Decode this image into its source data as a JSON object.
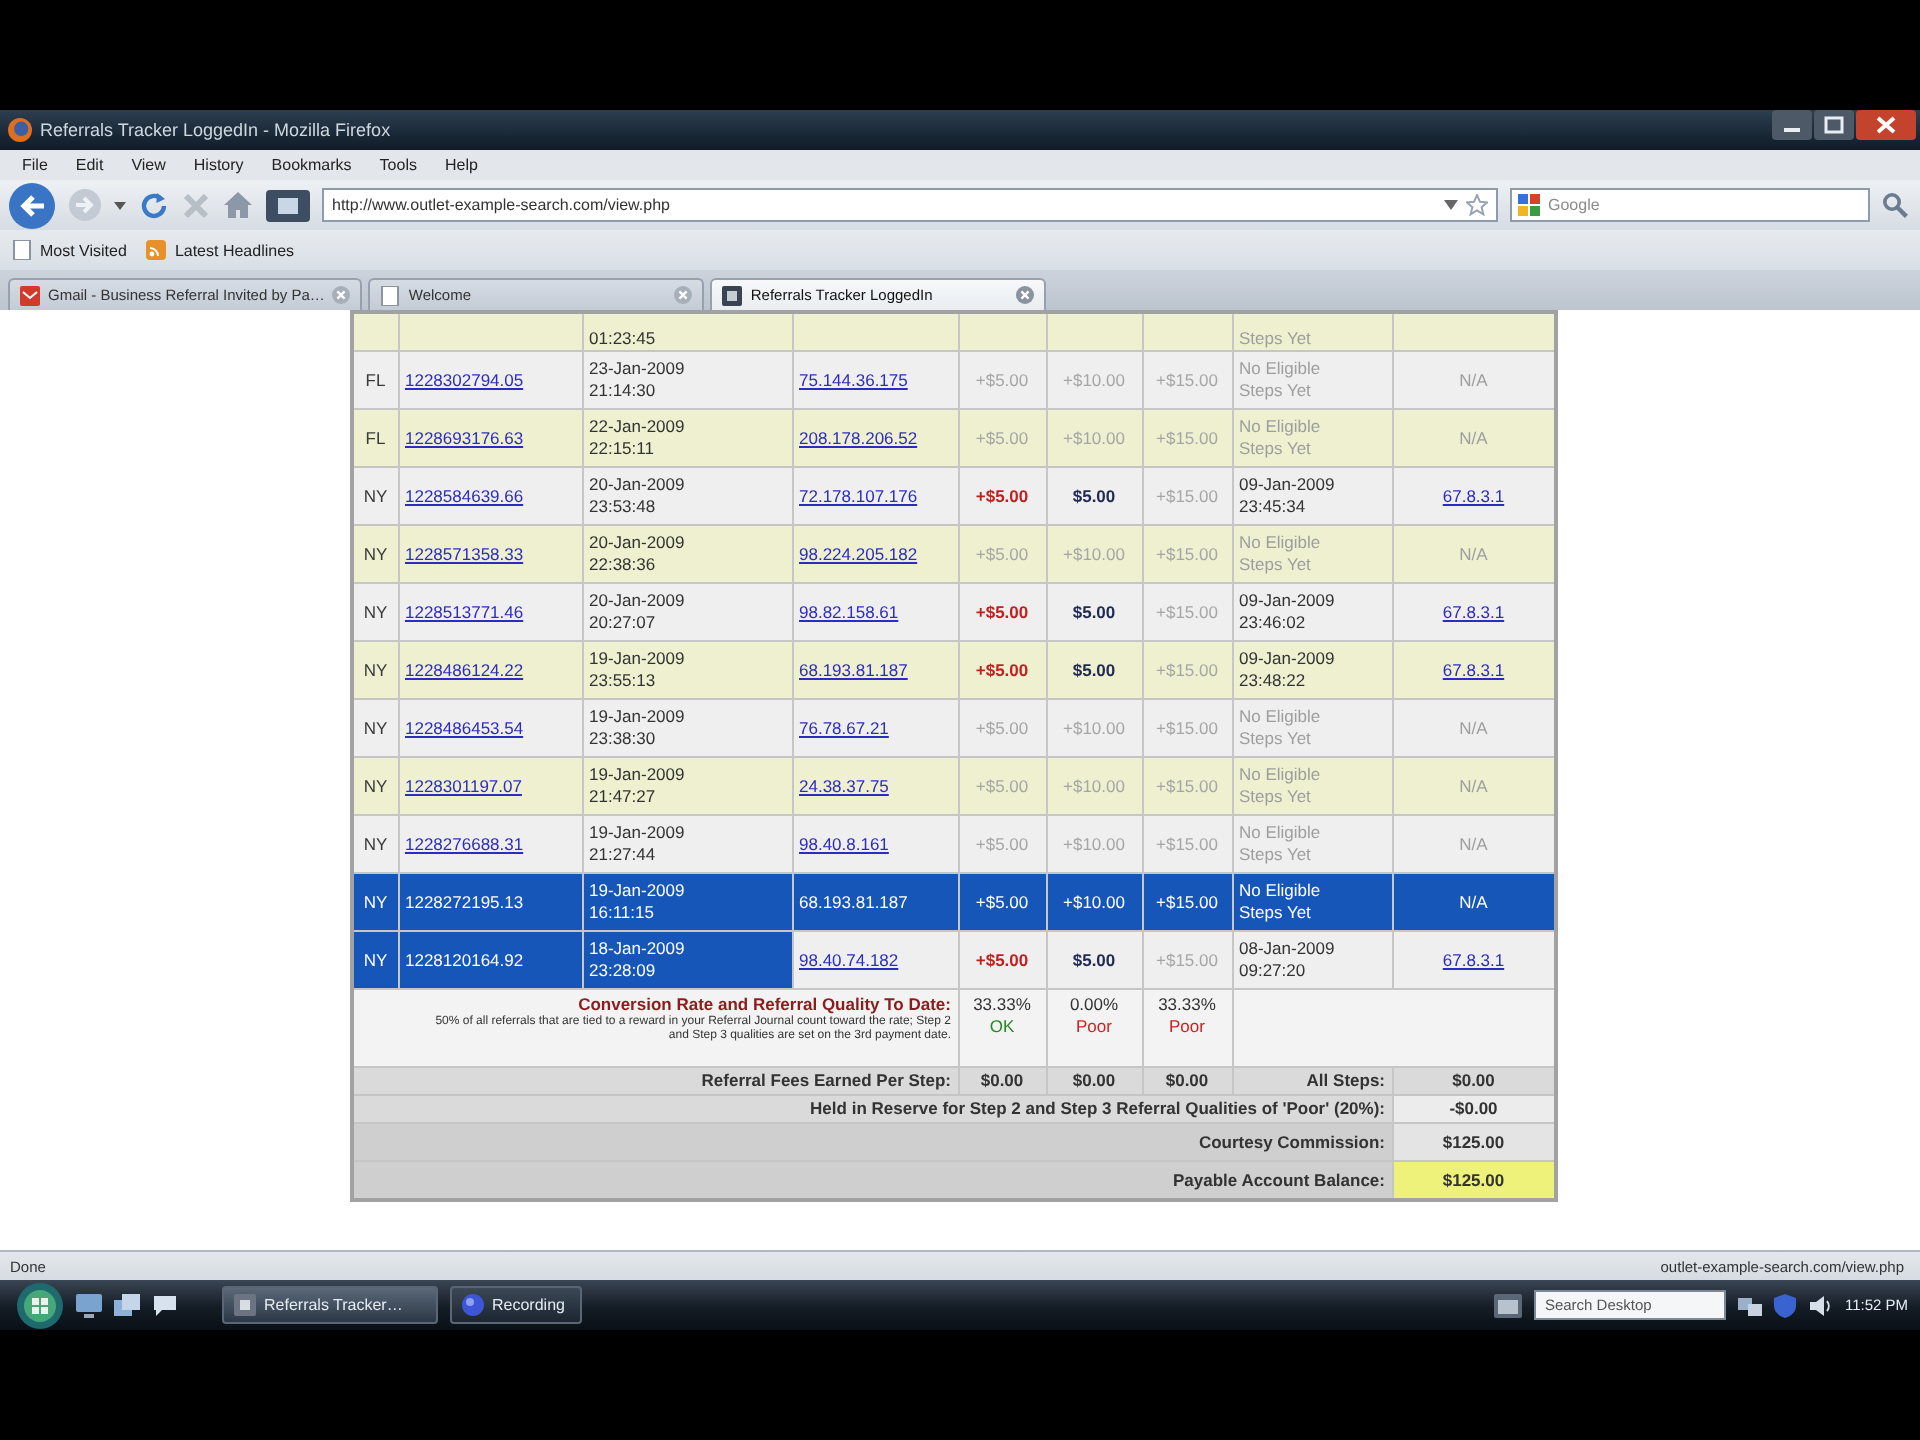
{
  "window": {
    "title": "Referrals Tracker LoggedIn - Mozilla Firefox"
  },
  "menu": [
    "File",
    "Edit",
    "View",
    "History",
    "Bookmarks",
    "Tools",
    "Help"
  ],
  "navigation": {
    "address": "http://www.outlet-example-search.com/view.php",
    "search_placeholder": "Google"
  },
  "bookmarks": [
    "Most Visited",
    "Latest Headlines"
  ],
  "tabs": [
    {
      "label": "Gmail - Business Referral Invited by Pa…",
      "selected": false
    },
    {
      "label": "Welcome",
      "selected": false
    },
    {
      "label": "Referrals Tracker LoggedIn",
      "selected": true
    }
  ],
  "table": {
    "partial_row": {
      "time": "01:23:45",
      "result": "Steps Yet"
    },
    "rows": [
      {
        "flag": "FL",
        "id": "1228302794.05",
        "date": "23-Jan-2009",
        "time": "21:14:30",
        "ip": "75.144.36.175",
        "amounts": [
          {
            "text": "+$5.00",
            "kind": "muted"
          },
          {
            "text": "+$10.00",
            "kind": "muted"
          },
          {
            "text": "+$15.00",
            "kind": "muted"
          }
        ],
        "result": {
          "kind": "pending",
          "lines": [
            "No Eligible",
            "Steps Yet"
          ]
        },
        "detail": {
          "kind": "na",
          "text": "N/A"
        },
        "selected": false,
        "partly_selected": false
      },
      {
        "flag": "FL",
        "id": "1228693176.63",
        "date": "22-Jan-2009",
        "time": "22:15:11",
        "ip": "208.178.206.52",
        "amounts": [
          {
            "text": "+$5.00",
            "kind": "muted"
          },
          {
            "text": "+$10.00",
            "kind": "muted"
          },
          {
            "text": "+$15.00",
            "kind": "muted"
          }
        ],
        "result": {
          "kind": "pending",
          "lines": [
            "No Eligible",
            "Steps Yet"
          ]
        },
        "detail": {
          "kind": "na",
          "text": "N/A"
        },
        "selected": false,
        "partly_selected": false
      },
      {
        "flag": "NY",
        "id": "1228584639.66",
        "date": "20-Jan-2009",
        "time": "23:53:48",
        "ip": "72.178.107.176",
        "amounts": [
          {
            "text": "+$5.00",
            "kind": "alert"
          },
          {
            "text": "$5.00",
            "kind": "strong"
          },
          {
            "text": "+$15.00",
            "kind": "muted"
          }
        ],
        "result": {
          "kind": "date",
          "lines": [
            "09-Jan-2009",
            "23:45:34"
          ]
        },
        "detail": {
          "kind": "link",
          "text": "67.8.3.1"
        },
        "selected": false,
        "partly_selected": false
      },
      {
        "flag": "NY",
        "id": "1228571358.33",
        "date": "20-Jan-2009",
        "time": "22:38:36",
        "ip": "98.224.205.182",
        "amounts": [
          {
            "text": "+$5.00",
            "kind": "muted"
          },
          {
            "text": "+$10.00",
            "kind": "muted"
          },
          {
            "text": "+$15.00",
            "kind": "muted"
          }
        ],
        "result": {
          "kind": "pending",
          "lines": [
            "No Eligible",
            "Steps Yet"
          ]
        },
        "detail": {
          "kind": "na",
          "text": "N/A"
        },
        "selected": false,
        "partly_selected": false
      },
      {
        "flag": "NY",
        "id": "1228513771.46",
        "date": "20-Jan-2009",
        "time": "20:27:07",
        "ip": "98.82.158.61",
        "amounts": [
          {
            "text": "+$5.00",
            "kind": "alert"
          },
          {
            "text": "$5.00",
            "kind": "strong"
          },
          {
            "text": "+$15.00",
            "kind": "muted"
          }
        ],
        "result": {
          "kind": "date",
          "lines": [
            "09-Jan-2009",
            "23:46:02"
          ]
        },
        "detail": {
          "kind": "link",
          "text": "67.8.3.1"
        },
        "selected": false,
        "partly_selected": false
      },
      {
        "flag": "NY",
        "id": "1228486124.22",
        "date": "19-Jan-2009",
        "time": "23:55:13",
        "ip": "68.193.81.187",
        "amounts": [
          {
            "text": "+$5.00",
            "kind": "alert"
          },
          {
            "text": "$5.00",
            "kind": "strong"
          },
          {
            "text": "+$15.00",
            "kind": "muted"
          }
        ],
        "result": {
          "kind": "date",
          "lines": [
            "09-Jan-2009",
            "23:48:22"
          ]
        },
        "detail": {
          "kind": "link",
          "text": "67.8.3.1"
        },
        "selected": false,
        "partly_selected": false
      },
      {
        "flag": "NY",
        "id": "1228486453.54",
        "date": "19-Jan-2009",
        "time": "23:38:30",
        "ip": "76.78.67.21",
        "amounts": [
          {
            "text": "+$5.00",
            "kind": "muted"
          },
          {
            "text": "+$10.00",
            "kind": "muted"
          },
          {
            "text": "+$15.00",
            "kind": "muted"
          }
        ],
        "result": {
          "kind": "pending",
          "lines": [
            "No Eligible",
            "Steps Yet"
          ]
        },
        "detail": {
          "kind": "na",
          "text": "N/A"
        },
        "selected": false,
        "partly_selected": false
      },
      {
        "flag": "NY",
        "id": "1228301197.07",
        "date": "19-Jan-2009",
        "time": "21:47:27",
        "ip": "24.38.37.75",
        "amounts": [
          {
            "text": "+$5.00",
            "kind": "muted"
          },
          {
            "text": "+$10.00",
            "kind": "muted"
          },
          {
            "text": "+$15.00",
            "kind": "muted"
          }
        ],
        "result": {
          "kind": "pending",
          "lines": [
            "No Eligible",
            "Steps Yet"
          ]
        },
        "detail": {
          "kind": "na",
          "text": "N/A"
        },
        "selected": false,
        "partly_selected": false
      },
      {
        "flag": "NY",
        "id": "1228276688.31",
        "date": "19-Jan-2009",
        "time": "21:27:44",
        "ip": "98.40.8.161",
        "amounts": [
          {
            "text": "+$5.00",
            "kind": "muted"
          },
          {
            "text": "+$10.00",
            "kind": "muted"
          },
          {
            "text": "+$15.00",
            "kind": "muted"
          }
        ],
        "result": {
          "kind": "pending",
          "lines": [
            "No Eligible",
            "Steps Yet"
          ]
        },
        "detail": {
          "kind": "na",
          "text": "N/A"
        },
        "selected": false,
        "partly_selected": false
      },
      {
        "flag": "NY",
        "id": "1228272195.13",
        "date": "19-Jan-2009",
        "time": "16:11:15",
        "ip": "68.193.81.187",
        "amounts": [
          {
            "text": "+$5.00",
            "kind": "muted"
          },
          {
            "text": "+$10.00",
            "kind": "muted"
          },
          {
            "text": "+$15.00",
            "kind": "muted"
          }
        ],
        "result": {
          "kind": "pending",
          "lines": [
            "No Eligible",
            "Steps Yet"
          ]
        },
        "detail": {
          "kind": "na",
          "text": "N/A"
        },
        "selected": true,
        "partly_selected": false
      },
      {
        "flag": "NY",
        "id": "1228120164.92",
        "date": "18-Jan-2009",
        "time": "23:28:09",
        "ip": "98.40.74.182",
        "amounts": [
          {
            "text": "+$5.00",
            "kind": "alert"
          },
          {
            "text": "$5.00",
            "kind": "strong"
          },
          {
            "text": "+$15.00",
            "kind": "muted"
          }
        ],
        "result": {
          "kind": "date",
          "lines": [
            "08-Jan-2009",
            "09:27:20"
          ]
        },
        "detail": {
          "kind": "link",
          "text": "67.8.3.1"
        },
        "selected": false,
        "partly_selected": true
      }
    ],
    "conversion": {
      "label": "Conversion Rate and Referral Quality To Date:",
      "note": "50% of all referrals that are tied to a reward in your Referral Journal count toward the rate; Step 2 and Step 3 qualities are set on the 3rd payment date.",
      "rates": [
        {
          "value": "33.33%",
          "grade": "OK",
          "kind": "good"
        },
        {
          "value": "0.00%",
          "grade": "Poor",
          "kind": "poor"
        },
        {
          "value": "33.33%",
          "grade": "Poor",
          "kind": "poor"
        }
      ]
    },
    "totals": {
      "per_step_label": "Referral Fees Earned Per Step:",
      "per_step": [
        "$0.00",
        "$0.00",
        "$0.00"
      ],
      "all_label": "All Steps:",
      "all": "$0.00",
      "reserve_label": "Held in Reserve for Step 2 and Step 3 Referral Qualities of 'Poor' (20%):",
      "reserve": "-$0.00",
      "commission_label": "Courtesy Commission:",
      "commission": "$125.00",
      "balance_label": "Payable Account Balance:",
      "balance": "$125.00"
    }
  },
  "status_bar": {
    "text": "Done",
    "url": "outlet-example-search.com/view.php"
  },
  "taskbar": {
    "tasks": [
      {
        "label": "Referrals Tracker…",
        "selected": true
      },
      {
        "label": "Recording",
        "selected": false
      }
    ],
    "search_placeholder": "Search Desktop",
    "clock": "11:52 PM"
  }
}
